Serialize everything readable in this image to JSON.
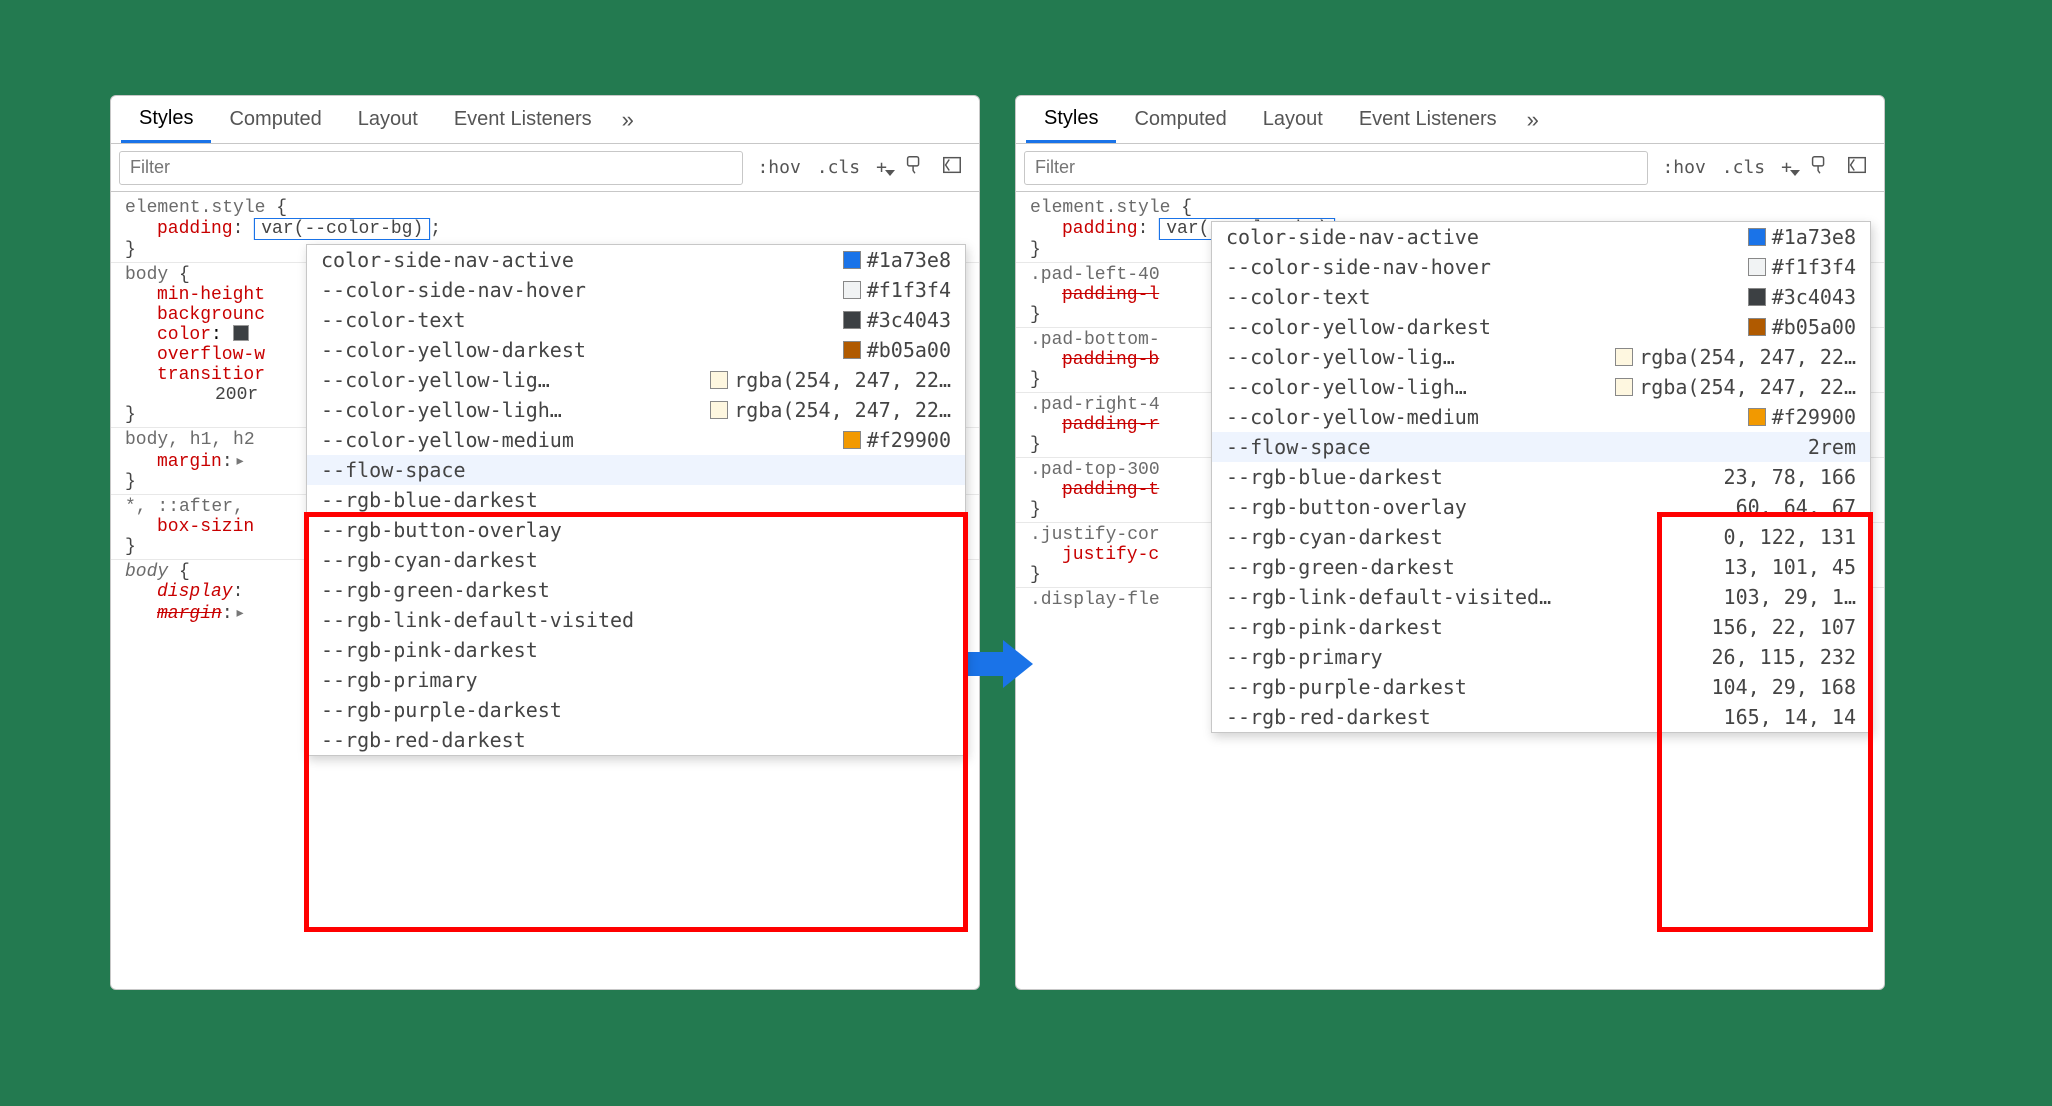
{
  "tabs": [
    "Styles",
    "Computed",
    "Layout",
    "Event Listeners"
  ],
  "active_tab": "Styles",
  "filter_placeholder": "Filter",
  "toolbar": {
    "hov": ":hov",
    "cls": ".cls",
    "plus": "+"
  },
  "element_style": {
    "selector": "element.style",
    "prop": "padding",
    "value_edit": "var(--color-bg)",
    "tail": ";"
  },
  "left_rules": [
    {
      "selector": "body {",
      "props": [
        {
          "name": "min-height",
          "trunc": true
        },
        {
          "name": "backgrounc",
          "trunc": true
        },
        {
          "name": "color",
          "swatch": "#3c4043",
          "trunc": true,
          "after": ":"
        },
        {
          "name": "overflow-w",
          "trunc": true
        },
        {
          "name": "transitior",
          "trunc": true
        }
      ],
      "cont_line": "200r"
    },
    {
      "selector": "body, h1, h2",
      "props": [
        {
          "name": "margin",
          "disclosure": true
        }
      ]
    },
    {
      "selector": "*, ::after,",
      "props": [
        {
          "name": "box-sizin",
          "trunc": true
        }
      ]
    },
    {
      "selector_italic": "body",
      "props": [
        {
          "name": "display",
          "italic": true
        },
        {
          "name": "margin",
          "italic": true,
          "strike": true,
          "disclosure": true
        }
      ]
    }
  ],
  "right_rules": [
    {
      "selector": ".pad-left-40",
      "props": [
        {
          "name": "padding-l",
          "strike": true,
          "trunc": true
        }
      ]
    },
    {
      "selector": ".pad-bottom-",
      "props": [
        {
          "name": "padding-b",
          "strike": true,
          "trunc": true
        }
      ]
    },
    {
      "selector": ".pad-right-4",
      "props": [
        {
          "name": "padding-r",
          "strike": true,
          "trunc": true
        }
      ]
    },
    {
      "selector": ".pad-top-300",
      "props": [
        {
          "name": "padding-t",
          "strike": true,
          "trunc": true
        }
      ]
    },
    {
      "selector": ".justify-cor",
      "props": [
        {
          "name": "justify-c",
          "trunc": true
        }
      ]
    },
    {
      "selector_partial": ".display-fle"
    }
  ],
  "popup_upper": [
    {
      "name": "color-side-nav-active",
      "hex": "#1a73e8",
      "color": "#1a73e8",
      "cutoff_left": true
    },
    {
      "name": "--color-side-nav-hover",
      "hex": "#f1f3f4",
      "color": "#f1f3f4"
    },
    {
      "name": "--color-text",
      "hex": "#3c4043",
      "color": "#3c4043"
    },
    {
      "name": "--color-yellow-darkest",
      "hex": "#b05a00",
      "color": "#b05a00"
    },
    {
      "name": "--color-yellow-lig…",
      "rgba": "rgba(254, 247, 22…",
      "color": "#fef7e0"
    },
    {
      "name": "--color-yellow-ligh…",
      "rgba": "rgba(254, 247, 22…",
      "color": "#fef7e0"
    },
    {
      "name": "--color-yellow-medium",
      "hex": "#f29900",
      "color": "#f29900"
    }
  ],
  "popup_left_lower": [
    {
      "name": "--flow-space",
      "highlight": true
    },
    {
      "name": "--rgb-blue-darkest"
    },
    {
      "name": "--rgb-button-overlay"
    },
    {
      "name": "--rgb-cyan-darkest"
    },
    {
      "name": "--rgb-green-darkest"
    },
    {
      "name": "--rgb-link-default-visited"
    },
    {
      "name": "--rgb-pink-darkest"
    },
    {
      "name": "--rgb-primary"
    },
    {
      "name": "--rgb-purple-darkest"
    },
    {
      "name": "--rgb-red-darkest"
    }
  ],
  "popup_right_lower": [
    {
      "name": "--flow-space",
      "val": "2rem",
      "highlight": true
    },
    {
      "name": "--rgb-blue-darkest",
      "val": "23, 78, 166"
    },
    {
      "name": "--rgb-button-overlay",
      "val": "60, 64, 67"
    },
    {
      "name": "--rgb-cyan-darkest",
      "val": "0, 122, 131"
    },
    {
      "name": "--rgb-green-darkest",
      "val": "13, 101, 45"
    },
    {
      "name": "--rgb-link-default-visited…",
      "val": "103, 29, 1…"
    },
    {
      "name": "--rgb-pink-darkest",
      "val": "156, 22, 107"
    },
    {
      "name": "--rgb-primary",
      "val": "26, 115, 232"
    },
    {
      "name": "--rgb-purple-darkest",
      "val": "104, 29, 168"
    },
    {
      "name": "--rgb-red-darkest",
      "val": "165, 14, 14"
    }
  ]
}
